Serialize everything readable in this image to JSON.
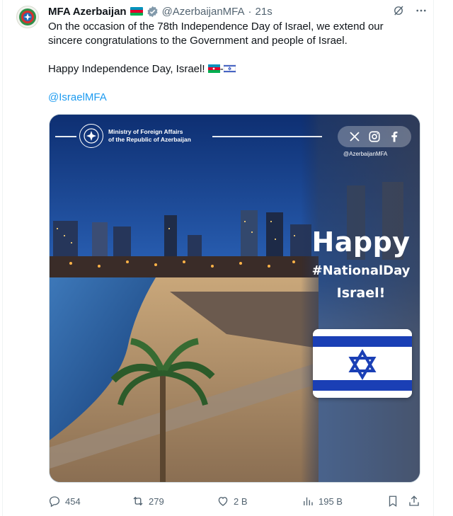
{
  "tweet": {
    "display_name": "MFA Azerbaijan",
    "handle": "@AzerbaijanMFA",
    "separator": "·",
    "time": "21s",
    "text_line1": "On the occasion of the 78th Independence Day of Israel, we extend our",
    "text_line2": "sincere congratulations to the Government and people of Israel.",
    "text_line3": "Happy Independence Day, Israel!",
    "text_dash": "-",
    "mention": "@IsraelMFA"
  },
  "media": {
    "ministry_line1": "Ministry of Foreign Affairs",
    "ministry_line2": "of the Republic of Azerbaijan",
    "social_handle": "@AzerbaijanMFA",
    "headline": "Happy",
    "hashtag": "#NationalDay",
    "country": "Israel!"
  },
  "actions": {
    "replies": "454",
    "reposts": "279",
    "likes": "2 B",
    "views": "195 B"
  },
  "colors": {
    "accent": "#1d9bf0",
    "muted": "#536471",
    "flag_az_blue": "#0092bc",
    "flag_az_red": "#e4002b",
    "flag_az_green": "#00af50",
    "israel_blue": "#1a3fb5"
  },
  "icons": [
    "emblem-icon",
    "azerbaijan-flag-icon",
    "verified-badge-icon",
    "grok-icon",
    "more-icon",
    "x-logo-icon",
    "instagram-icon",
    "facebook-icon",
    "israel-flag-icon",
    "reply-icon",
    "repost-icon",
    "like-icon",
    "views-icon",
    "bookmark-icon",
    "share-icon"
  ]
}
